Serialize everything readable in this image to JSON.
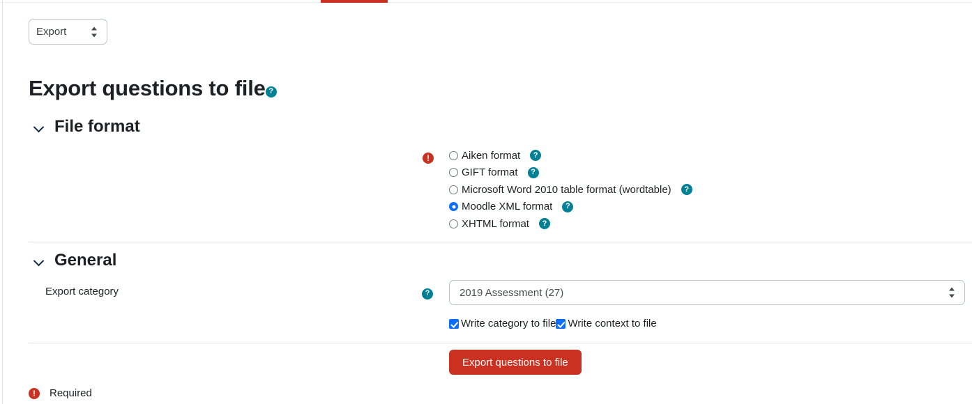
{
  "tabstrip": {
    "active_tab_indicator": true
  },
  "action_select": {
    "value": "Export",
    "icon": "updown-arrows-icon"
  },
  "header": {
    "title": "Export questions to file",
    "help_icon": "help-circle-icon",
    "help_label": "?"
  },
  "sections": {
    "file_format": {
      "heading": "File format",
      "collapse_icon": "chevron-down-icon",
      "required_marker": "!",
      "options": [
        {
          "label": "Aiken format",
          "selected": false,
          "help_label": "?"
        },
        {
          "label": "GIFT format",
          "selected": false,
          "help_label": "?"
        },
        {
          "label": "Microsoft Word 2010 table format (wordtable)",
          "selected": false,
          "help_label": "?"
        },
        {
          "label": "Moodle XML format",
          "selected": true,
          "help_label": "?"
        },
        {
          "label": "XHTML format",
          "selected": false,
          "help_label": "?"
        }
      ]
    },
    "general": {
      "heading": "General",
      "collapse_icon": "chevron-down-icon",
      "export_category": {
        "label": "Export category",
        "help_label": "?",
        "value": "2019 Assessment (27)",
        "icon": "updown-arrows-icon"
      },
      "checkboxes": [
        {
          "label": "Write category to file",
          "checked": true
        },
        {
          "label": "Write context to file",
          "checked": true
        }
      ]
    }
  },
  "submit": {
    "label": "Export questions to file"
  },
  "footer": {
    "required_label": "Required",
    "required_marker": "!"
  },
  "colors": {
    "accent_red": "#ca3120",
    "help_teal": "#008196",
    "control_blue": "#0d6efd",
    "text": "#1d2125",
    "border": "#bcc4ca",
    "divider": "#e3e5e7"
  }
}
